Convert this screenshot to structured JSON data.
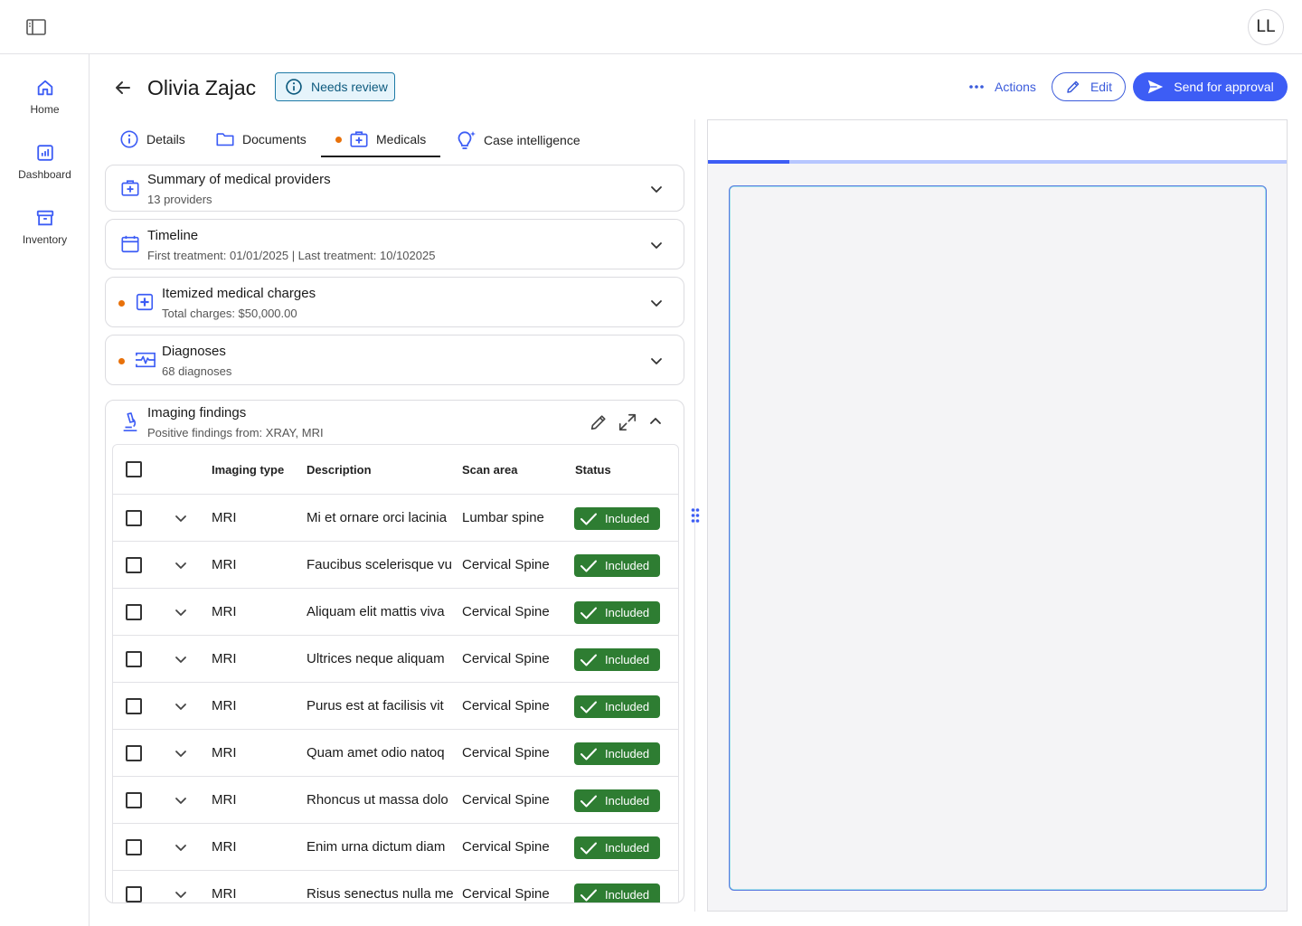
{
  "header": {
    "avatar_initials": "LL"
  },
  "nav": {
    "items": [
      {
        "label": "Home",
        "icon": "home-icon"
      },
      {
        "label": "Dashboard",
        "icon": "dashboard-icon"
      },
      {
        "label": "Inventory",
        "icon": "inventory-icon"
      }
    ]
  },
  "case": {
    "title": "Olivia Zajac",
    "status": "Needs review"
  },
  "toolbar": {
    "actions_label": "Actions",
    "edit_label": "Edit",
    "approve_label": "Send for approval"
  },
  "tabs": [
    {
      "label": "Details",
      "icon": "info-icon"
    },
    {
      "label": "Documents",
      "icon": "folder-icon"
    },
    {
      "label": "Medicals",
      "icon": "medical-kit-icon",
      "active": true
    },
    {
      "label": "Case intelligence",
      "icon": "lightbulb-sparkle-icon"
    }
  ],
  "sections": {
    "providers": {
      "title": "Summary of medical providers",
      "subtitle": "13 providers"
    },
    "timeline": {
      "title": "Timeline",
      "subtitle": "First treatment: 01/01/2025 | Last treatment: 10/102025"
    },
    "charges": {
      "title": "Itemized medical charges",
      "subtitle": "Total charges: $50,000.00"
    },
    "diagnoses": {
      "title": "Diagnoses",
      "subtitle": "68 diagnoses"
    },
    "imaging": {
      "title": "Imaging findings",
      "subtitle": "Positive findings from: XRAY, MRI"
    }
  },
  "table": {
    "columns": {
      "type": "Imaging type",
      "description": "Description",
      "scan_area": "Scan area",
      "status": "Status"
    },
    "rows": [
      {
        "type": "MRI",
        "description": "Mi et ornare orci lacinia",
        "scan_area": "Lumbar spine",
        "status": "Included"
      },
      {
        "type": "MRI",
        "description": "Faucibus scelerisque vu",
        "scan_area": "Cervical Spine",
        "status": "Included"
      },
      {
        "type": "MRI",
        "description": "Aliquam elit mattis viva",
        "scan_area": "Cervical Spine",
        "status": "Included"
      },
      {
        "type": "MRI",
        "description": "Ultrices neque aliquam",
        "scan_area": "Cervical Spine",
        "status": "Included"
      },
      {
        "type": "MRI",
        "description": "Purus est at facilisis vit",
        "scan_area": "Cervical Spine",
        "status": "Included"
      },
      {
        "type": "MRI",
        "description": "Quam amet odio natoq",
        "scan_area": "Cervical Spine",
        "status": "Included"
      },
      {
        "type": "MRI",
        "description": "Rhoncus ut massa dolo",
        "scan_area": "Cervical Spine",
        "status": "Included"
      },
      {
        "type": "MRI",
        "description": "Enim urna dictum diam",
        "scan_area": "Cervical Spine",
        "status": "Included"
      },
      {
        "type": "MRI",
        "description": "Risus senectus nulla me",
        "scan_area": "Cervical Spine",
        "status": "Included"
      }
    ]
  },
  "preview": {
    "progress": 0.14
  },
  "colors": {
    "accent": "#3d5df5",
    "status_included": "#2e7d32",
    "needs_review": "#1e7aa6",
    "alert_dot": "#e8710a"
  }
}
